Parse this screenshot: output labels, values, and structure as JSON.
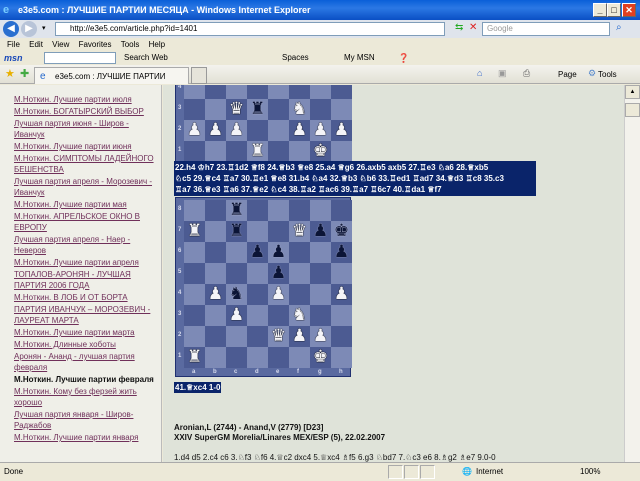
{
  "window": {
    "title": "e3e5.com : ЛУЧШИЕ ПАРТИИ МЕСЯЦА - Windows Internet Explorer",
    "min": "_",
    "max": "□",
    "close": "✕"
  },
  "address": {
    "url": "http://e3e5.com/article.php?id=1401",
    "search_placeholder": "Google"
  },
  "menu": [
    "File",
    "Edit",
    "View",
    "Favorites",
    "Tools",
    "Help"
  ],
  "msn": {
    "logo": "msn",
    "search_web": "Search Web",
    "spaces": "Spaces",
    "my_msn": "My MSN"
  },
  "tab": {
    "label": "e3e5.com : ЛУЧШИЕ ПАРТИИ МЕСЯЦА"
  },
  "command_bar": {
    "page": "Page",
    "tools": "Tools"
  },
  "sidebar": {
    "items": [
      {
        "label": "М.Ноткин. Лучшие партии июля"
      },
      {
        "label": "М.Ноткин. БОГАТЫРСКИЙ ВЫБОР"
      },
      {
        "label": "Лучшая партия июня - Широв - Иванчук"
      },
      {
        "label": "М.Ноткин. Лучшие партии июня"
      },
      {
        "label": "М.Ноткин. СИМПТОМЫ ЛАДЕЙНОГО БЕШЕНСТВА"
      },
      {
        "label": "Лучшая партия апреля - Морозевич - Иванчук"
      },
      {
        "label": "М.Ноткин. Лучшие партии мая"
      },
      {
        "label": "М.Ноткин. АПРЕЛЬСКОЕ ОКНО В ЕВРОПУ"
      },
      {
        "label": "Лучшая партия апреля - Наер - Неверов"
      },
      {
        "label": "М.Ноткин. Лучшие партии апреля"
      },
      {
        "label": "ТОПАЛОВ-АРОНЯН - ЛУЧШАЯ ПАРТИЯ 2006 ГОДА"
      },
      {
        "label": "М.Ноткин. В ЛОБ И ОТ БОРТА"
      },
      {
        "label": "ПАРТИЯ ИВАНЧУК – МОРОЗЕВИЧ - ЛАУРЕАТ МАРТА"
      },
      {
        "label": "М.Ноткин. Лучшие партии марта"
      },
      {
        "label": "М.Ноткин. Длинные хоботы"
      },
      {
        "label": "Аронян - Ананд - лучшая партия февраля"
      },
      {
        "label": "М.Ноткин. Лучшие партии февраля",
        "current": true
      },
      {
        "label": "М.Ноткин. Кому без ферзей жить хорошо"
      },
      {
        "label": "Лучшая партия января - Широв-Раджабов"
      },
      {
        "label": "М.Ноткин. Лучшие партии января"
      }
    ]
  },
  "boards": [
    {
      "pieces": [
        {
          "sq": "c3",
          "p": "♛",
          "c": "w"
        },
        {
          "sq": "d3",
          "p": "♜",
          "c": "b"
        },
        {
          "sq": "f3",
          "p": "♞",
          "c": "w"
        },
        {
          "sq": "a2",
          "p": "♟",
          "c": "w"
        },
        {
          "sq": "b2",
          "p": "♟",
          "c": "w"
        },
        {
          "sq": "c2",
          "p": "♟",
          "c": "w"
        },
        {
          "sq": "f2",
          "p": "♟",
          "c": "w"
        },
        {
          "sq": "g2",
          "p": "♟",
          "c": "w"
        },
        {
          "sq": "h2",
          "p": "♟",
          "c": "w"
        },
        {
          "sq": "d1",
          "p": "♜",
          "c": "w"
        },
        {
          "sq": "g1",
          "p": "♚",
          "c": "w"
        }
      ]
    },
    {
      "pieces": [
        {
          "sq": "c8",
          "p": "♜",
          "c": "b"
        },
        {
          "sq": "a7",
          "p": "♜",
          "c": "w"
        },
        {
          "sq": "c7",
          "p": "♜",
          "c": "b"
        },
        {
          "sq": "f7",
          "p": "♛",
          "c": "w"
        },
        {
          "sq": "g7",
          "p": "♟",
          "c": "b"
        },
        {
          "sq": "h7",
          "p": "♚",
          "c": "b"
        },
        {
          "sq": "d6",
          "p": "♟",
          "c": "b"
        },
        {
          "sq": "e6",
          "p": "♟",
          "c": "b"
        },
        {
          "sq": "h6",
          "p": "♟",
          "c": "b"
        },
        {
          "sq": "e5",
          "p": "♟",
          "c": "b"
        },
        {
          "sq": "b4",
          "p": "♟",
          "c": "w"
        },
        {
          "sq": "c4",
          "p": "♞",
          "c": "b"
        },
        {
          "sq": "e4",
          "p": "♟",
          "c": "w"
        },
        {
          "sq": "h4",
          "p": "♟",
          "c": "w"
        },
        {
          "sq": "c3",
          "p": "♟",
          "c": "w"
        },
        {
          "sq": "f3",
          "p": "♞",
          "c": "w"
        },
        {
          "sq": "e2",
          "p": "♛",
          "c": "w"
        },
        {
          "sq": "f2",
          "p": "♟",
          "c": "w"
        },
        {
          "sq": "g2",
          "p": "♟",
          "c": "w"
        },
        {
          "sq": "a1",
          "p": "♜",
          "c": "w"
        },
        {
          "sq": "g1",
          "p": "♚",
          "c": "w"
        }
      ]
    }
  ],
  "article": {
    "moves1": [
      "22.h4 ♔h7 23.♖1d2 ♕f8 24.♕b3 ♕e8 25.a4 ♕g6 26.axb5 axb5 27.♖e3 ♘a6 28.♕xb5",
      "♘c5 29.♕c4 ♖a7 30.♖e1 ♕e8 31.b4 ♘a4 32.♕b3 ♘b6 33.♖ed1 ♖ad7 34.♕d3 ♖c8 35.c3",
      "♖a7 36.♕e3 ♖a6 37.♕e2 ♘c4 38.♖a2 ♖ac6 39.♖a7 ♖6c7 40.♖da1 ♕f7"
    ],
    "final": "41.♕xc4 1-0",
    "game_header": "Aronian,L (2744) - Anand,V (2779) [D23]",
    "event": "XXIV SuperGM Morelia/Linares MEX/ESP (5), 22.02.2007",
    "moves2": "1.d4 d5 2.c4 c6 3.♘f3 ♘f6 4.♕c2 dxc4 5.♕xc4 ♗f5 6.g3 ♘bd7 7.♘c3 e6 8.♗g2 ♗e7 9.0-0"
  },
  "status": {
    "text": "Done",
    "zone": "Internet",
    "zoom": "100%"
  }
}
